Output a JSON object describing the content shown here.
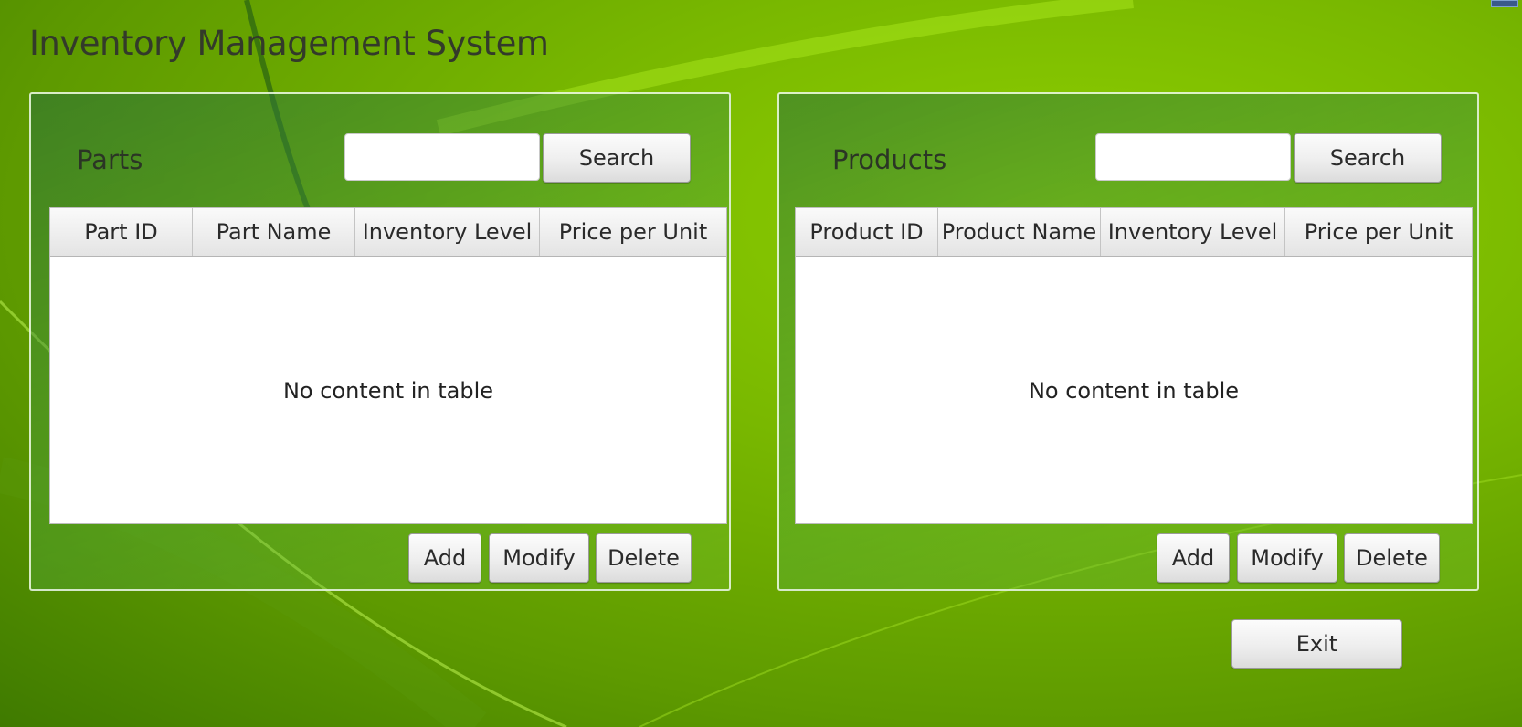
{
  "app": {
    "title": "Inventory Management System"
  },
  "parts": {
    "title": "Parts",
    "search_placeholder": "",
    "search_value": "",
    "search_label": "Search",
    "columns": [
      "Part ID",
      "Part Name",
      "Inventory Level",
      "Price per Unit"
    ],
    "rows": [],
    "empty_text": "No content in table",
    "add_label": "Add",
    "modify_label": "Modify",
    "delete_label": "Delete"
  },
  "products": {
    "title": "Products",
    "search_placeholder": "",
    "search_value": "",
    "search_label": "Search",
    "columns": [
      "Product ID",
      "Product Name",
      "Inventory Level",
      "Price per Unit"
    ],
    "rows": [],
    "empty_text": "No content in table",
    "add_label": "Add",
    "modify_label": "Modify",
    "delete_label": "Delete"
  },
  "footer": {
    "exit_label": "Exit"
  },
  "colors": {
    "background_green": "#79b800",
    "panel_border": "#f0fae6",
    "title_text": "#333a2a"
  }
}
